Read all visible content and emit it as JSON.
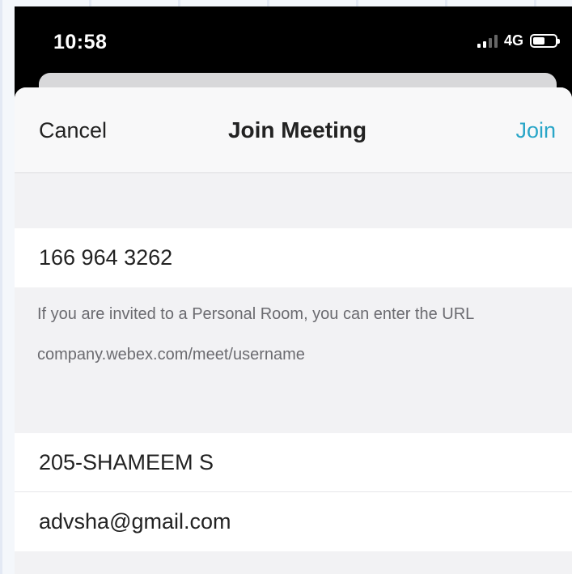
{
  "status_bar": {
    "time": "10:58",
    "network": "4G",
    "signal_bars_on": 2,
    "signal_bars_total": 4,
    "battery_level": 0.55
  },
  "nav": {
    "cancel_label": "Cancel",
    "title": "Join Meeting",
    "join_label": "Join"
  },
  "form": {
    "meeting_number": "166 964 3262",
    "hint_text": "If you are invited to a Personal Room, you can enter the URL",
    "hint_url": "company.webex.com/meet/username",
    "display_name": "205-SHAMEEM S",
    "email": "advsha@gmail.com"
  },
  "colors": {
    "accent": "#2aa6c8",
    "status_bar_bg": "#000000",
    "sheet_bg": "#f2f2f4"
  }
}
